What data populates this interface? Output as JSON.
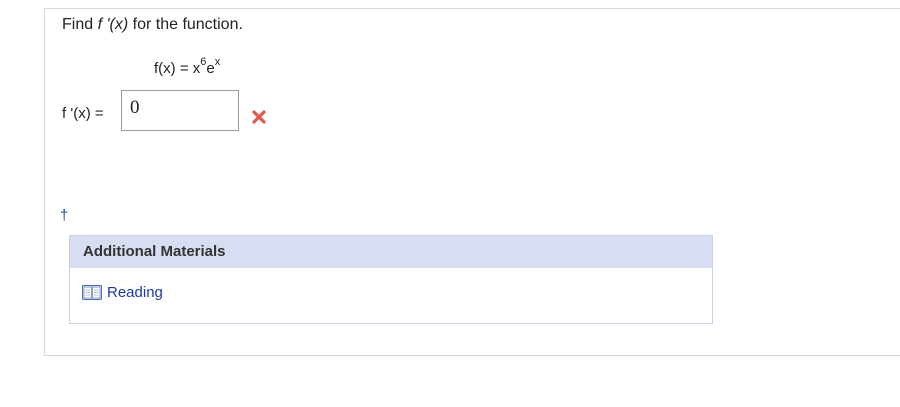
{
  "question": {
    "prefix": "Find ",
    "derivative": "f '(x)",
    "suffix": " for the function."
  },
  "function": {
    "lhs": "f(x) = x",
    "exponent1": "6",
    "base2": "e",
    "exponent2": "x"
  },
  "answer": {
    "label": "f '(x) =",
    "value": "0",
    "status": "incorrect"
  },
  "footnote": {
    "symbol": "†"
  },
  "materials": {
    "title": "Additional Materials",
    "items": [
      {
        "label": "Reading",
        "icon": "book-icon"
      }
    ]
  },
  "colors": {
    "incorrect": "#e0584f",
    "materials_header": "#d8def2",
    "link": "#1a3aa5"
  }
}
